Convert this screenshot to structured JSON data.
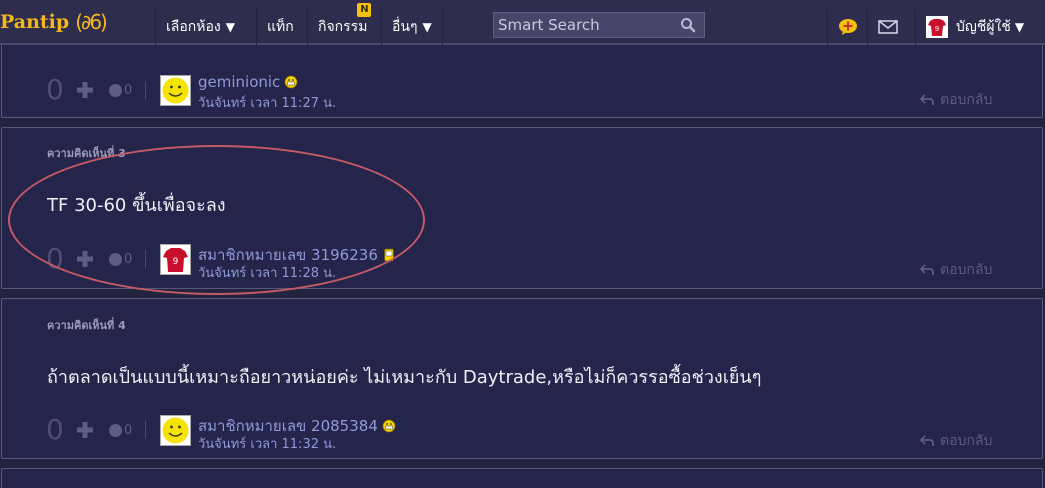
{
  "topbar": {
    "logo_text": "Pantip",
    "logo_mark": "(∂6)",
    "nav": [
      {
        "label": "เลือกห้อง",
        "caret": "▼"
      },
      {
        "label": "แท็ก",
        "caret": ""
      },
      {
        "label": "กิจกรรม",
        "caret": "",
        "badge": "N"
      },
      {
        "label": "อื่นๆ",
        "caret": "▼"
      }
    ],
    "search_placeholder": "Smart Search",
    "account_label": "บัญชีผู้ใช้",
    "account_caret": "▼",
    "icons": [
      "pantip-point-icon",
      "mail-icon",
      "avatar-shirt-icon"
    ]
  },
  "comments": [
    {
      "label": "",
      "text": "",
      "votes": "0",
      "emoji_count": "0",
      "author": "geminionic",
      "author_icon": "smiley-icon",
      "time": "วันจันทร์ เวลา 11:27 น.",
      "reply": "ตอบกลับ",
      "avatar": "yellow-smiley"
    },
    {
      "label": "ความคิดเห็นที่ 3",
      "text": "TF 30-60 ขึ้นเพื่อจะลง",
      "votes": "0",
      "emoji_count": "0",
      "author": "สมาชิกหมายเลข 3196236",
      "author_icon": "phone-icon",
      "time": "วันจันทร์ เวลา 11:28 น.",
      "reply": "ตอบกลับ",
      "avatar": "red-shirt"
    },
    {
      "label": "ความคิดเห็นที่ 4",
      "text": "ถ้าตลาดเป็นแบบนี้เหมาะถือยาวหน่อยค่ะ ไม่เหมาะกับ Daytrade,หรือไม่ก็ควรรอซื้อช่วงเย็นๆ",
      "votes": "0",
      "emoji_count": "0",
      "author": "สมาชิกหมายเลข 2085384",
      "author_icon": "smiley-icon",
      "time": "วันจันทร์ เวลา 11:32 น.",
      "reply": "ตอบกลับ",
      "avatar": "yellow-smiley"
    }
  ],
  "colors": {
    "background": "#24233f",
    "logo": "#f4b81b",
    "author": "#8e9ad9",
    "annotation": "#c55a66"
  }
}
